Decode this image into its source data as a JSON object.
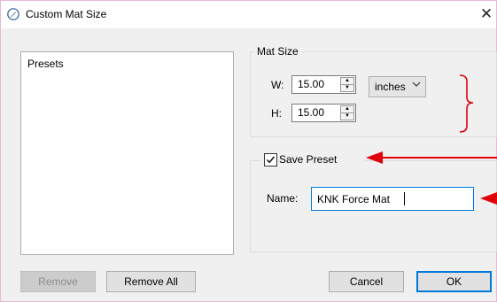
{
  "window": {
    "title": "Custom Mat Size",
    "close_glyph": "✕"
  },
  "presets": {
    "label": "Presets"
  },
  "mat_size": {
    "legend": "Mat Size",
    "width_label": "W:",
    "width_value": "15.00",
    "height_label": "H:",
    "height_value": "15.00",
    "units_value": "inches"
  },
  "save_preset": {
    "checked": true,
    "label": "Save Preset",
    "name_label": "Name:",
    "name_value": "KNK Force Mat"
  },
  "buttons": {
    "remove": "Remove",
    "remove_all": "Remove All",
    "cancel": "Cancel",
    "ok": "OK"
  },
  "annotation_color": "#e0000a",
  "icons": [
    "pen-icon",
    "close-icon",
    "spin-up-icon",
    "spin-down-icon",
    "chevron-down-icon",
    "checkmark-icon"
  ]
}
